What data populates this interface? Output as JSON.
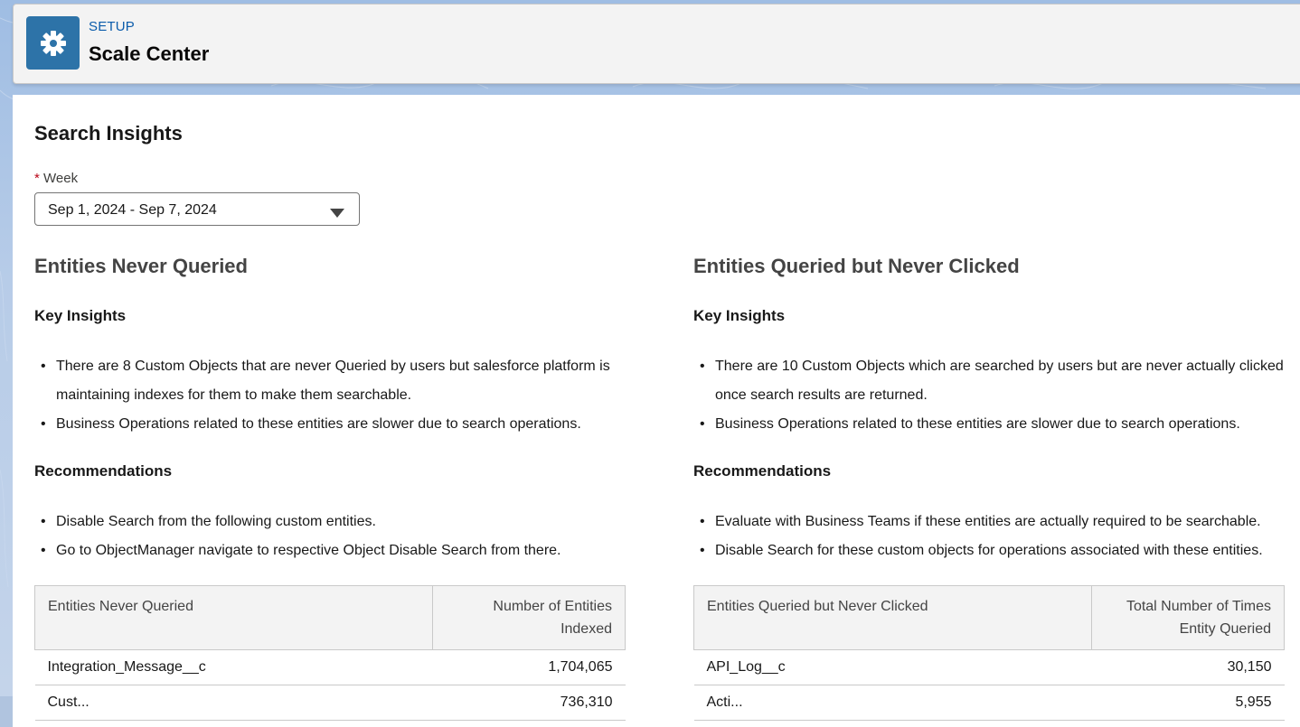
{
  "header": {
    "subtitle": "SETUP",
    "title": "Scale Center",
    "icon": "gear-icon",
    "icon_color": "#2d73a8"
  },
  "page": {
    "title": "Search Insights",
    "week": {
      "required_mark": "*",
      "label": "Week",
      "value": "Sep 1, 2024 - Sep 7, 2024"
    }
  },
  "left": {
    "title": "Entities Never Queried",
    "key_insights_heading": "Key Insights",
    "key_insights": [
      "There are 8 Custom Objects that are never Queried by users but salesforce platform is maintaining indexes for them to make them searchable.",
      "Business Operations related to these entities are slower due to search operations."
    ],
    "recommendations_heading": "Recommendations",
    "recommendations": [
      "Disable Search from the following custom entities.",
      "Go to ObjectManager navigate to respective Object Disable Search from there."
    ],
    "table": {
      "columns": [
        "Entities Never Queried",
        "Number of Entities Indexed"
      ],
      "rows": [
        [
          "Integration_Message__c",
          "1,704,065"
        ],
        [
          "Cust...",
          "736,310"
        ]
      ]
    }
  },
  "right": {
    "title": "Entities Queried but Never Clicked",
    "key_insights_heading": "Key Insights",
    "key_insights": [
      "There are 10 Custom Objects which are searched by users but are never actually clicked once search results are returned.",
      "Business Operations related to these entities are slower due to search operations."
    ],
    "recommendations_heading": "Recommendations",
    "recommendations": [
      "Evaluate with Business Teams if these entities are actually required to be searchable.",
      "Disable Search for these custom objects for operations associated with these entities."
    ],
    "table": {
      "columns": [
        "Entities Queried but Never Clicked",
        "Total Number of Times Entity Queried"
      ],
      "rows": [
        [
          "API_Log__c",
          "30,150"
        ],
        [
          "Acti...",
          "5,955"
        ]
      ]
    }
  }
}
